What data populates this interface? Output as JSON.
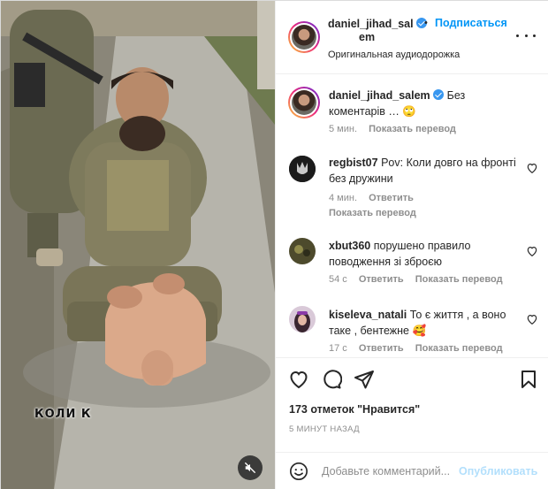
{
  "post": {
    "overlay_caption": "КОЛИ    К",
    "mute_icon": "speaker-muted-icon"
  },
  "header": {
    "username_line1": "daniel_jihad_sal",
    "username_line2": "em",
    "separator": "•",
    "follow_label": "Подписаться",
    "audio_label": "Оригинальная аудиодорожка"
  },
  "comments": [
    {
      "username": "daniel_jihad_salem",
      "verified": true,
      "text": "Без коментарів … 🙄",
      "time": "5 мин.",
      "reply": "",
      "translate": "Показать перевод"
    },
    {
      "username": "regbist07",
      "text": "Pov: Коли довго на фронті без дружини",
      "time": "4 мин.",
      "reply": "Ответить",
      "translate": "Показать перевод"
    },
    {
      "username": "xbut360",
      "text": "порушено правило поводження зі зброєю",
      "time": "54 с",
      "reply": "Ответить",
      "translate": "Показать перевод"
    },
    {
      "username": "kiseleva_natali",
      "text": "То є життя , а воно таке , бентежне 🥰",
      "time": "17 с",
      "reply": "Ответить",
      "translate": "Показать перевод"
    }
  ],
  "engagement": {
    "likes": "173 отметок \"Нравится\"",
    "posted": "5 МИНУТ НАЗАД"
  },
  "composer": {
    "placeholder": "Добавьте комментарий...",
    "publish_label": "Опубликовать"
  },
  "colors": {
    "link_blue": "#0095f6",
    "publish_disabled": "#b2dffc",
    "muted_text": "#8e8e8e",
    "verified_blue": "#3897f0"
  }
}
